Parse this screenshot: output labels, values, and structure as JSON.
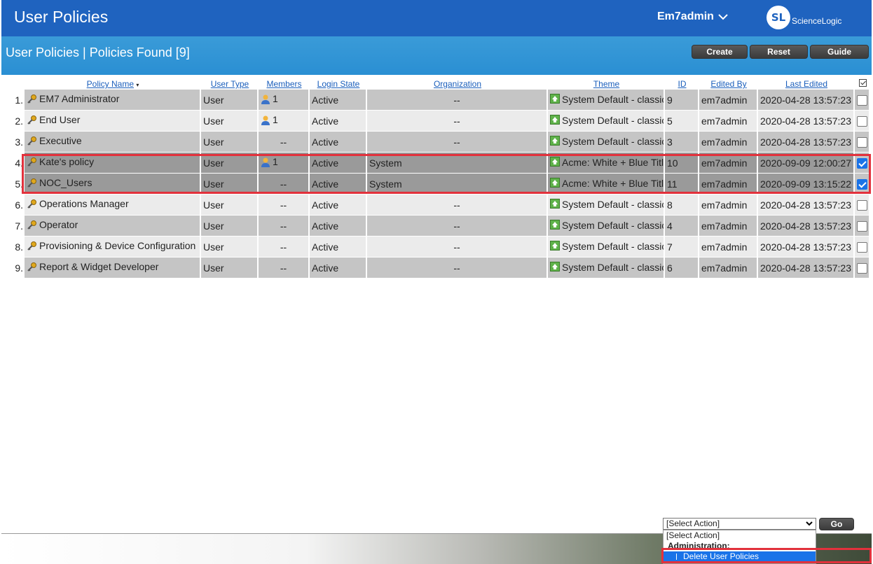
{
  "header": {
    "app_title": "User Policies",
    "user_name": "Em7admin",
    "logo_mark": "SL",
    "logo_text": "ScienceLogic"
  },
  "subheader": {
    "title": "User Policies | Policies Found [9]",
    "buttons": {
      "create": "Create",
      "reset": "Reset",
      "guide": "Guide"
    }
  },
  "columns": {
    "policy_name": "Policy Name",
    "user_type": "User Type",
    "members": "Members",
    "login_state": "Login State",
    "organization": "Organization",
    "theme": "Theme",
    "id": "ID",
    "edited_by": "Edited By",
    "last_edited": "Last Edited"
  },
  "rows": [
    {
      "num": "1.",
      "name": "EM7 Administrator",
      "user_type": "User",
      "members": "1",
      "has_member_icon": true,
      "login_state": "Active",
      "organization": "--",
      "theme": "System Default - classic",
      "id": "9",
      "edited_by": "em7admin",
      "last_edited": "2020-04-28 13:57:23",
      "checked": false
    },
    {
      "num": "2.",
      "name": "End User",
      "user_type": "User",
      "members": "1",
      "has_member_icon": true,
      "login_state": "Active",
      "organization": "--",
      "theme": "System Default - classic",
      "id": "5",
      "edited_by": "em7admin",
      "last_edited": "2020-04-28 13:57:23",
      "checked": false
    },
    {
      "num": "3.",
      "name": "Executive",
      "user_type": "User",
      "members": "--",
      "has_member_icon": false,
      "login_state": "Active",
      "organization": "--",
      "theme": "System Default - classic",
      "id": "3",
      "edited_by": "em7admin",
      "last_edited": "2020-04-28 13:57:23",
      "checked": false
    },
    {
      "num": "4.",
      "name": "Kate's policy",
      "user_type": "User",
      "members": "1",
      "has_member_icon": true,
      "login_state": "Active",
      "organization": "System",
      "theme": "Acme: White + Blue Title",
      "id": "10",
      "edited_by": "em7admin",
      "last_edited": "2020-09-09 12:00:27",
      "checked": true
    },
    {
      "num": "5.",
      "name": "NOC_Users",
      "user_type": "User",
      "members": "--",
      "has_member_icon": false,
      "login_state": "Active",
      "organization": "System",
      "theme": "Acme: White + Blue Title",
      "id": "11",
      "edited_by": "em7admin",
      "last_edited": "2020-09-09 13:15:22",
      "checked": true
    },
    {
      "num": "6.",
      "name": "Operations Manager",
      "user_type": "User",
      "members": "--",
      "has_member_icon": false,
      "login_state": "Active",
      "organization": "--",
      "theme": "System Default - classic",
      "id": "8",
      "edited_by": "em7admin",
      "last_edited": "2020-04-28 13:57:23",
      "checked": false
    },
    {
      "num": "7.",
      "name": "Operator",
      "user_type": "User",
      "members": "--",
      "has_member_icon": false,
      "login_state": "Active",
      "organization": "--",
      "theme": "System Default - classic",
      "id": "4",
      "edited_by": "em7admin",
      "last_edited": "2020-04-28 13:57:23",
      "checked": false
    },
    {
      "num": "8.",
      "name": "Provisioning & Device Configuration",
      "user_type": "User",
      "members": "--",
      "has_member_icon": false,
      "login_state": "Active",
      "organization": "--",
      "theme": "System Default - classic",
      "id": "7",
      "edited_by": "em7admin",
      "last_edited": "2020-04-28 13:57:23",
      "checked": false
    },
    {
      "num": "9.",
      "name": "Report & Widget Developer",
      "user_type": "User",
      "members": "--",
      "has_member_icon": false,
      "login_state": "Active",
      "organization": "--",
      "theme": "System Default - classic",
      "id": "6",
      "edited_by": "em7admin",
      "last_edited": "2020-04-28 13:57:23",
      "checked": false
    }
  ],
  "actions": {
    "select_value": "[Select Action]",
    "go_label": "Go",
    "dropdown_options": [
      "[Select Action]",
      "Administration:",
      "Delete User Policies"
    ]
  },
  "colors": {
    "topbar": "#1f63bf",
    "subbar": "#2a8fd3",
    "highlight": "#e2313c",
    "selected_option": "#1a73e8"
  }
}
